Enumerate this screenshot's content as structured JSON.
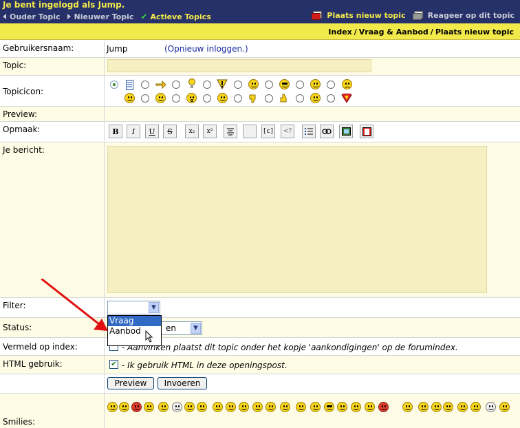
{
  "header": {
    "login_message": "Je bent ingelogd als Jump.",
    "nav": {
      "prev": "Ouder Topic",
      "next": "Nieuwer Topic",
      "active": "Actieve Topics"
    },
    "actions": {
      "new_topic": "Plaats nieuw topic",
      "reply": "Reageer op dit topic"
    }
  },
  "breadcrumb": {
    "items": [
      "Index",
      "Vraag & Aanbod",
      "Plaats nieuw topic"
    ],
    "separator": "/"
  },
  "form": {
    "username": {
      "label": "Gebruikersnaam:",
      "value": "Jump",
      "relogin": "(Opnieuw inloggen.)"
    },
    "topic": {
      "label": "Topic:",
      "value": ""
    },
    "topicicon": {
      "label": "Topicicon:",
      "selected": 0
    },
    "preview": {
      "label": "Preview:"
    },
    "format": {
      "label": "Opmaak:",
      "bold": "B",
      "italic": "I",
      "underline": "U",
      "strike": "S",
      "sub": "x₂",
      "sup": "x²",
      "code": "[c]",
      "html": "<?"
    },
    "message": {
      "label": "Je bericht:",
      "value": ""
    },
    "filter": {
      "label": "Filter:",
      "value": "",
      "options": [
        "Vraag",
        "Aanbod"
      ],
      "highlighted": "Vraag"
    },
    "status": {
      "label": "Status:",
      "value_partial": "en"
    },
    "index_mention": {
      "label": "Vermeld op index:",
      "text": "- Aanvinken plaatst dit topic onder het kopje 'aankondigingen' op de forumindex.",
      "checked": false
    },
    "html_use": {
      "label": "HTML gebruik:",
      "text": "- Ik gebruik HTML in deze openingspost.",
      "checked": true
    },
    "buttons": {
      "preview": "Preview",
      "submit": "Invoeren"
    },
    "smilies": {
      "label": "Smilies:"
    }
  },
  "colors": {
    "header_bg": "#26316a",
    "accent_yellow": "#f2e94a",
    "row_yellow": "#fefce4",
    "field_fill": "#f5efc2",
    "annotation_arrow": "#e01010"
  }
}
